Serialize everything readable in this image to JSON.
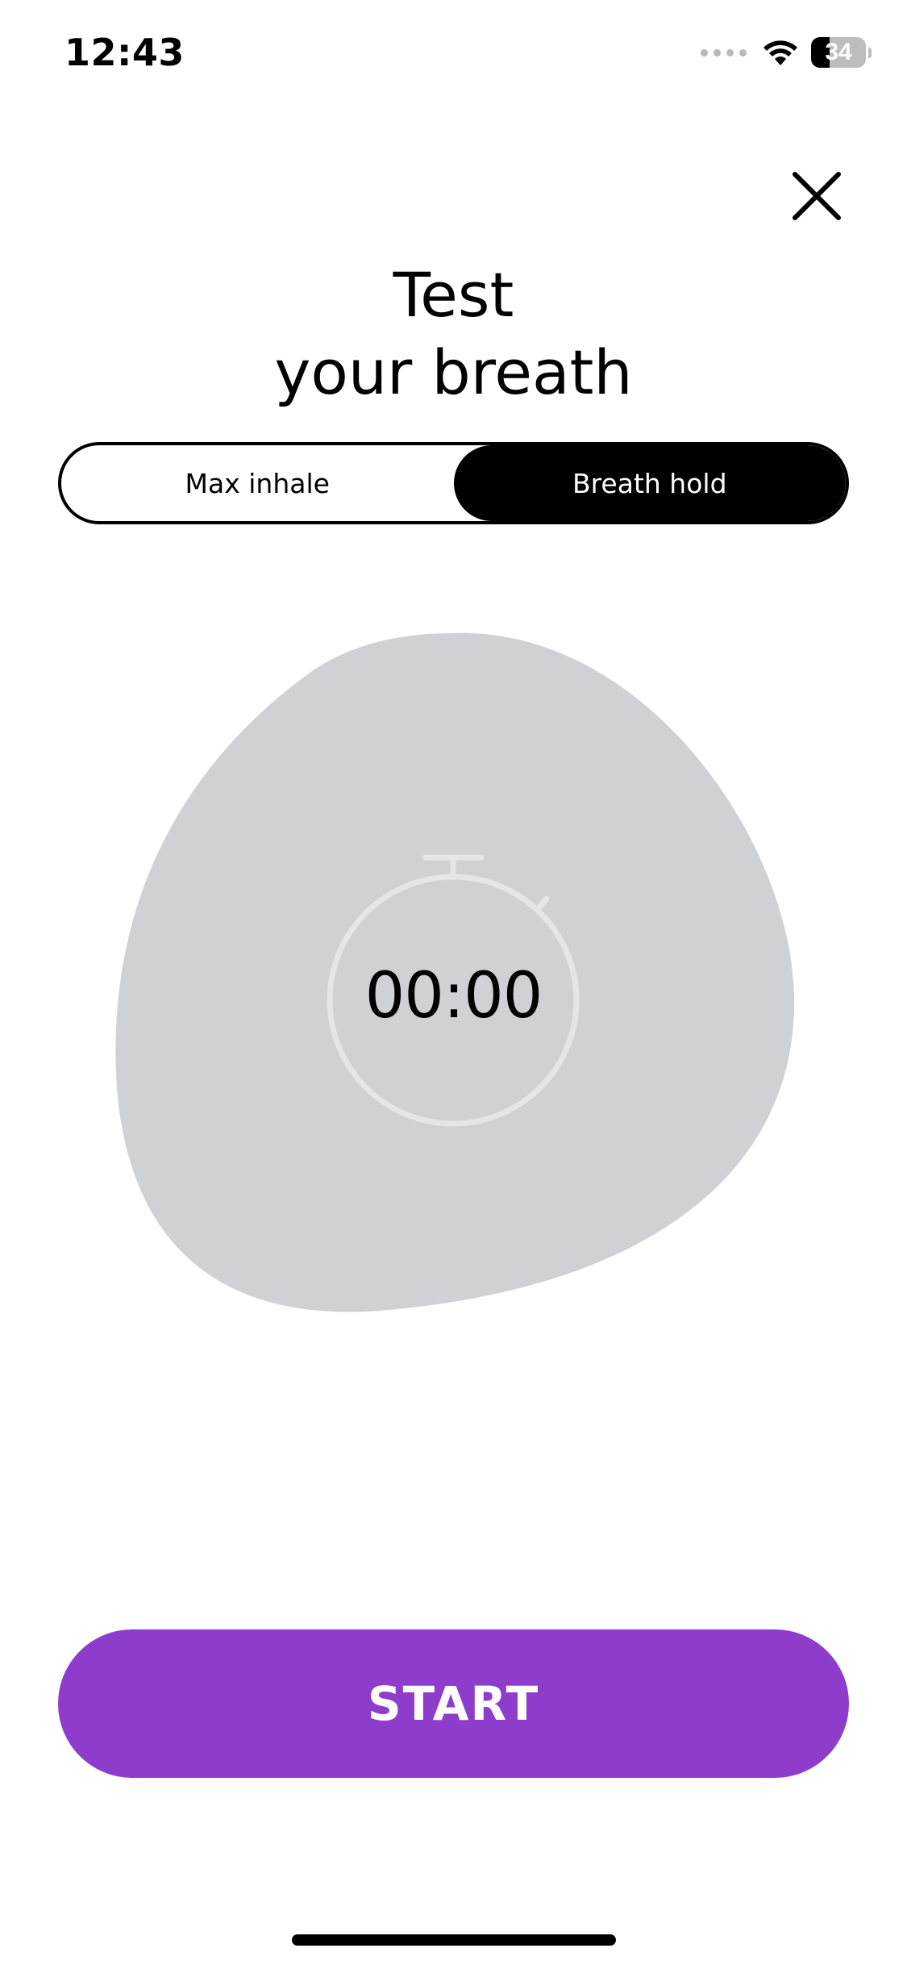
{
  "status_bar": {
    "time": "12:43",
    "battery_level": "34",
    "battery_percent": 34
  },
  "header": {
    "close_icon": "close-icon",
    "title_line1": "Test",
    "title_line2": "your breath"
  },
  "segment": {
    "options": [
      "Max inhale",
      "Breath hold"
    ],
    "selected": "Breath hold"
  },
  "timer": {
    "value": "00:00",
    "icon": "stopwatch-icon"
  },
  "actions": {
    "start_label": "START"
  },
  "colors": {
    "accent": "#8d3ccc",
    "blob": "#d0d1d5",
    "stopwatch_outline": "#e6e6e8"
  }
}
